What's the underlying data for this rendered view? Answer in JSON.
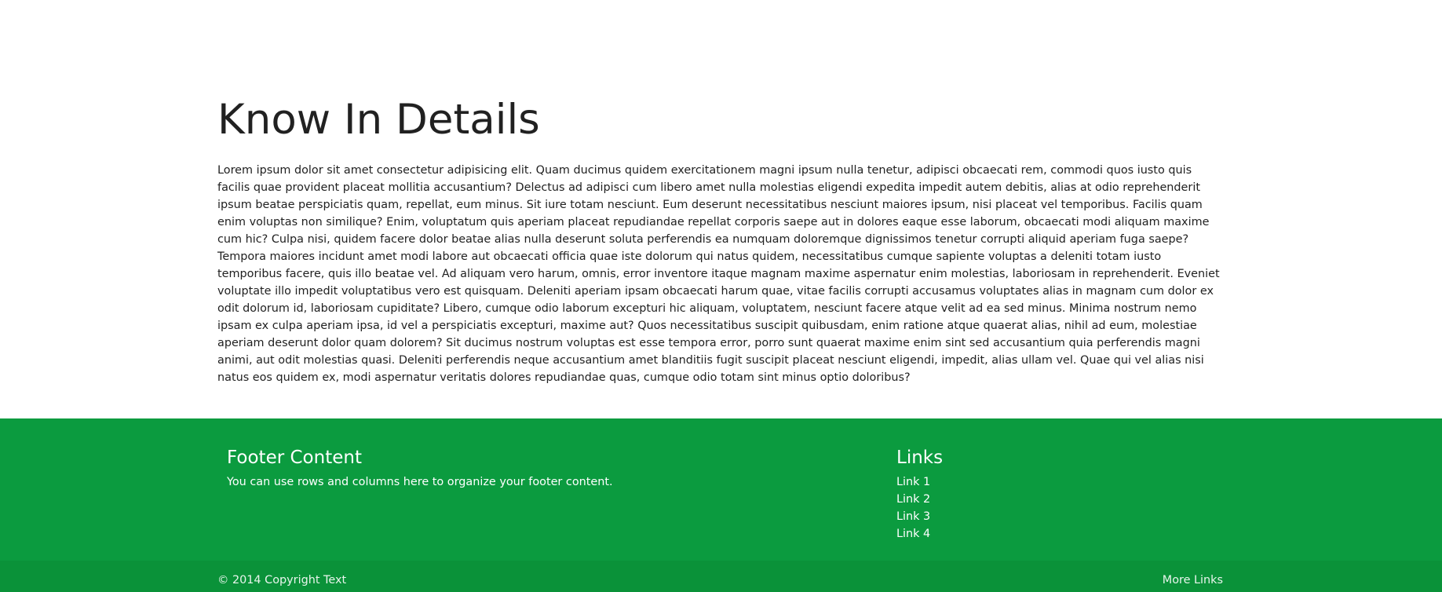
{
  "main": {
    "title": "Know In Details",
    "body": "Lorem ipsum dolor sit amet consectetur adipisicing elit. Quam ducimus quidem exercitationem magni ipsum nulla tenetur, adipisci obcaecati rem, commodi quos iusto quis facilis quae provident placeat mollitia accusantium? Delectus ad adipisci cum libero amet nulla molestias eligendi expedita impedit autem debitis, alias at odio reprehenderit ipsum beatae perspiciatis quam, repellat, eum minus. Sit iure totam nesciunt. Eum deserunt necessitatibus nesciunt maiores ipsum, nisi placeat vel temporibus. Facilis quam enim voluptas non similique? Enim, voluptatum quis aperiam placeat repudiandae repellat corporis saepe aut in dolores eaque esse laborum, obcaecati modi aliquam maxime cum hic? Culpa nisi, quidem facere dolor beatae alias nulla deserunt soluta perferendis ea numquam doloremque dignissimos tenetur corrupti aliquid aperiam fuga saepe? Tempora maiores incidunt amet modi labore aut obcaecati officia quae iste dolorum qui natus quidem, necessitatibus cumque sapiente voluptas a deleniti totam iusto temporibus facere, quis illo beatae vel. Ad aliquam vero harum, omnis, error inventore itaque magnam maxime aspernatur enim molestias, laboriosam in reprehenderit. Eveniet voluptate illo impedit voluptatibus vero est quisquam. Deleniti aperiam ipsam obcaecati harum quae, vitae facilis corrupti accusamus voluptates alias in magnam cum dolor ex odit dolorum id, laboriosam cupiditate? Libero, cumque odio laborum excepturi hic aliquam, voluptatem, nesciunt facere atque velit ad ea sed minus. Minima nostrum nemo ipsam ex culpa aperiam ipsa, id vel a perspiciatis excepturi, maxime aut? Quos necessitatibus suscipit quibusdam, enim ratione atque quaerat alias, nihil ad eum, molestiae aperiam deserunt dolor quam dolorem? Sit ducimus nostrum voluptas est esse tempora error, porro sunt quaerat maxime enim sint sed accusantium quia perferendis magni animi, aut odit molestias quasi. Deleniti perferendis neque accusantium amet blanditiis fugit suscipit placeat nesciunt eligendi, impedit, alias ullam vel. Quae qui vel alias nisi natus eos quidem ex, modi aspernatur veritatis dolores repudiandae quas, cumque odio totam sint minus optio doloribus?"
  },
  "footer": {
    "content_title": "Footer Content",
    "content_text": "You can use rows and columns here to organize your footer content.",
    "links_title": "Links",
    "links": [
      {
        "label": "Link 1"
      },
      {
        "label": "Link 2"
      },
      {
        "label": "Link 3"
      },
      {
        "label": "Link 4"
      }
    ],
    "copyright": "© 2014 Copyright Text",
    "more_links": "More Links"
  },
  "colors": {
    "footer_bg": "#0b9b3f",
    "copyright_bg": "#0a9239",
    "text": "#212121"
  }
}
